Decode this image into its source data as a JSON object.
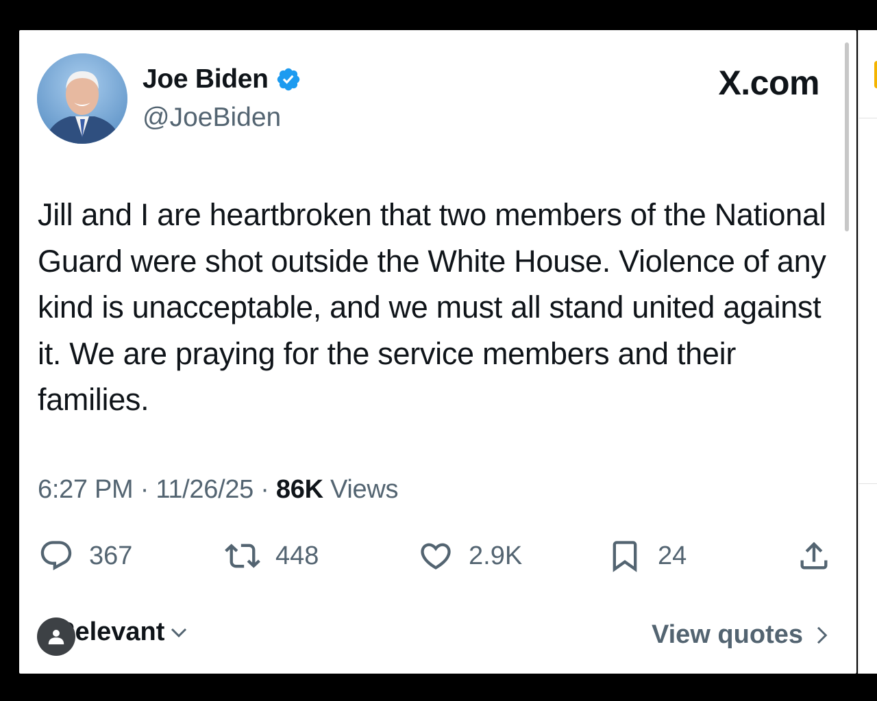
{
  "author": {
    "name": "Joe Biden",
    "handle": "@JoeBiden",
    "verified": true,
    "avatar_icon": "profile-photo"
  },
  "brand": {
    "label": "X.com"
  },
  "tweet": {
    "text": "Jill and I are heartbroken that two members of the National Guard were shot outside the White House. Violence of any kind is unacceptable, and we must all stand united against it. We are praying for the service members and their families.",
    "time": "6:27 PM",
    "date": "11/26/25",
    "views_count": "86K",
    "views_label": "Views",
    "separator": "·"
  },
  "actions": {
    "replies": "367",
    "reposts": "448",
    "likes": "2.9K",
    "bookmarks": "24"
  },
  "footer": {
    "sort_label": "Relevant",
    "view_quotes": "View quotes"
  },
  "colors": {
    "verified": "#1d9bf0",
    "secondary_text": "#536471",
    "primary_text": "#0f1419"
  }
}
